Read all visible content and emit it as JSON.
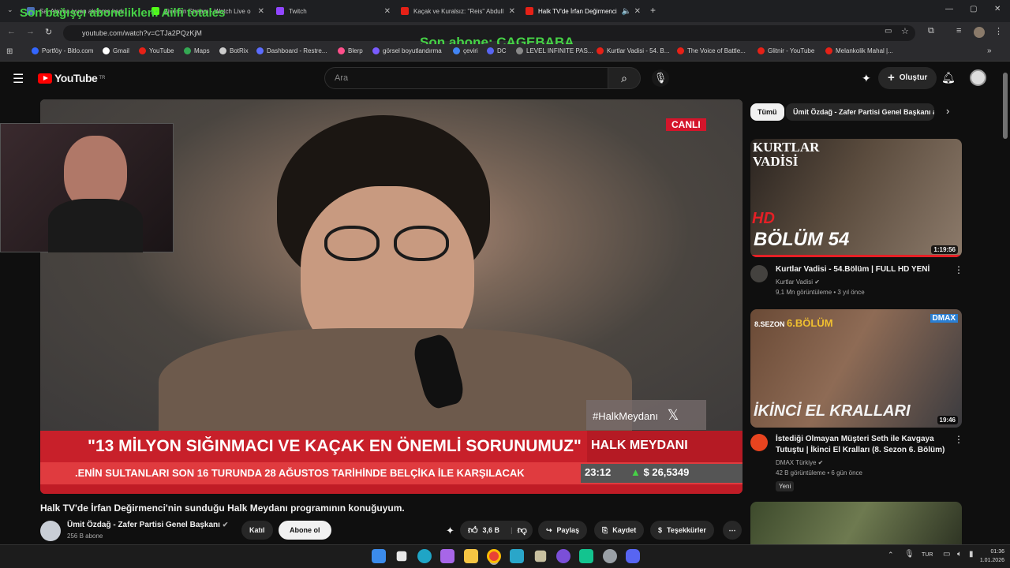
{
  "overlay": {
    "top_text": "Son bağışçı aboneliklen: Ailfi totales",
    "abone": "Son abone: CAGEBABA"
  },
  "tabs": [
    {
      "label": "Sa. Alayna iyuan aksama kadı..",
      "color": "#4a6fb5"
    },
    {
      "label": "Ziverbin Stream - Watch Live o",
      "color": "#53fc18"
    },
    {
      "label": "Twitch",
      "color": "#9146ff"
    },
    {
      "label": "Kaçak ve Kuralsız: \"Reis\" Abdull",
      "color": "#e62117"
    },
    {
      "label": "Halk TV'de İrfan Değirmenci",
      "color": "#e62117"
    }
  ],
  "address": {
    "url": "youtube.com/watch?v=CTJa2PQzKjM"
  },
  "bookmarks": [
    {
      "label": "Portföy - Bitlo.com",
      "color": "#3366ff"
    },
    {
      "label": "Gmail",
      "color": "#ffffff"
    },
    {
      "label": "YouTube",
      "color": "#e62117"
    },
    {
      "label": "Maps",
      "color": "#34a853"
    },
    {
      "label": "BotRix",
      "color": "#cccccc"
    },
    {
      "label": "Dashboard - Restre...",
      "color": "#5b6cff"
    },
    {
      "label": "Blerp",
      "color": "#ff4f8b"
    },
    {
      "label": "görsel boyutlandırma",
      "color": "#7a5cff"
    },
    {
      "label": "çeviri",
      "color": "#4285f4"
    },
    {
      "label": "DC",
      "color": "#5865f2"
    },
    {
      "label": "LEVEL INFINITE PAS...",
      "color": "#888888"
    },
    {
      "label": "Kurtlar Vadisi - 54. B...",
      "color": "#e62117"
    },
    {
      "label": "The Voice of Battle...",
      "color": "#e62117"
    },
    {
      "label": "Glitnir - YouTube",
      "color": "#e62117"
    },
    {
      "label": "Melankolik Mahal |...",
      "color": "#e62117"
    }
  ],
  "youtube": {
    "logo": "YouTube",
    "region": "TR",
    "search_placeholder": "Ara",
    "create_label": "Oluştur"
  },
  "video": {
    "live_badge": "CANLI",
    "lower_third": "\"13 MİLYON SIĞINMACI VE KAÇAK EN ÖNEMLİ SORUNUMUZ\"",
    "program": "HALK MEYDANI",
    "ticker": ".ENİN SULTANLARI SON 16 TURUNDA 28 AĞUSTOS TARİHİNDE BELÇİKA İLE KARŞILACAK",
    "time": "23:12",
    "price": "$ 26,5349",
    "hashtag": "#HalkMeydanı",
    "title": "Halk TV'de İrfan Değirmenci'nin sunduğu Halk Meydanı programının konuğuyum.",
    "channel": "Ümit Özdağ - Zafer Partisi Genel Başkanı",
    "subs": "256 B abone",
    "join": "Katıl",
    "subscribe": "Abone ol",
    "likes": "3,6 B",
    "share": "Paylaş",
    "save": "Kaydet",
    "thanks": "Teşekkürler"
  },
  "chips": {
    "all": "Tümü",
    "second": "Ümit Özdağ - Zafer Partisi Genel Başkanı a"
  },
  "related": [
    {
      "title": "Kurtlar Vadisi - 54.Bölüm | FULL HD YENİ",
      "channel": "Kurtlar Vadisi",
      "meta": "9,1 Mn görüntüleme • 3 yıl önce",
      "duration": "1:19:56",
      "thumb_a": "KURTLAR",
      "thumb_b": "VADİSİ",
      "thumb_hd": "HD",
      "thumb_ep": "BÖLÜM 54",
      "badge": ""
    },
    {
      "title": "İstediği Olmayan Müşteri Seth ile Kavgaya Tutuştu | İkinci El Kralları (8. Sezon 6. Bölüm)",
      "channel": "DMAX Türkiye",
      "meta": "42 B görüntüleme • 6 gün önce",
      "duration": "19:46",
      "thumb_a": "8.SEZON",
      "thumb_b": "6.BÖLÜM",
      "thumb_hd": "DMAX",
      "thumb_ep": "İKİNCİ EL KRALLARI",
      "badge": "Yeni"
    }
  ],
  "system": {
    "lang": "TUR",
    "time": "01:36",
    "date": "1.01.2026"
  }
}
